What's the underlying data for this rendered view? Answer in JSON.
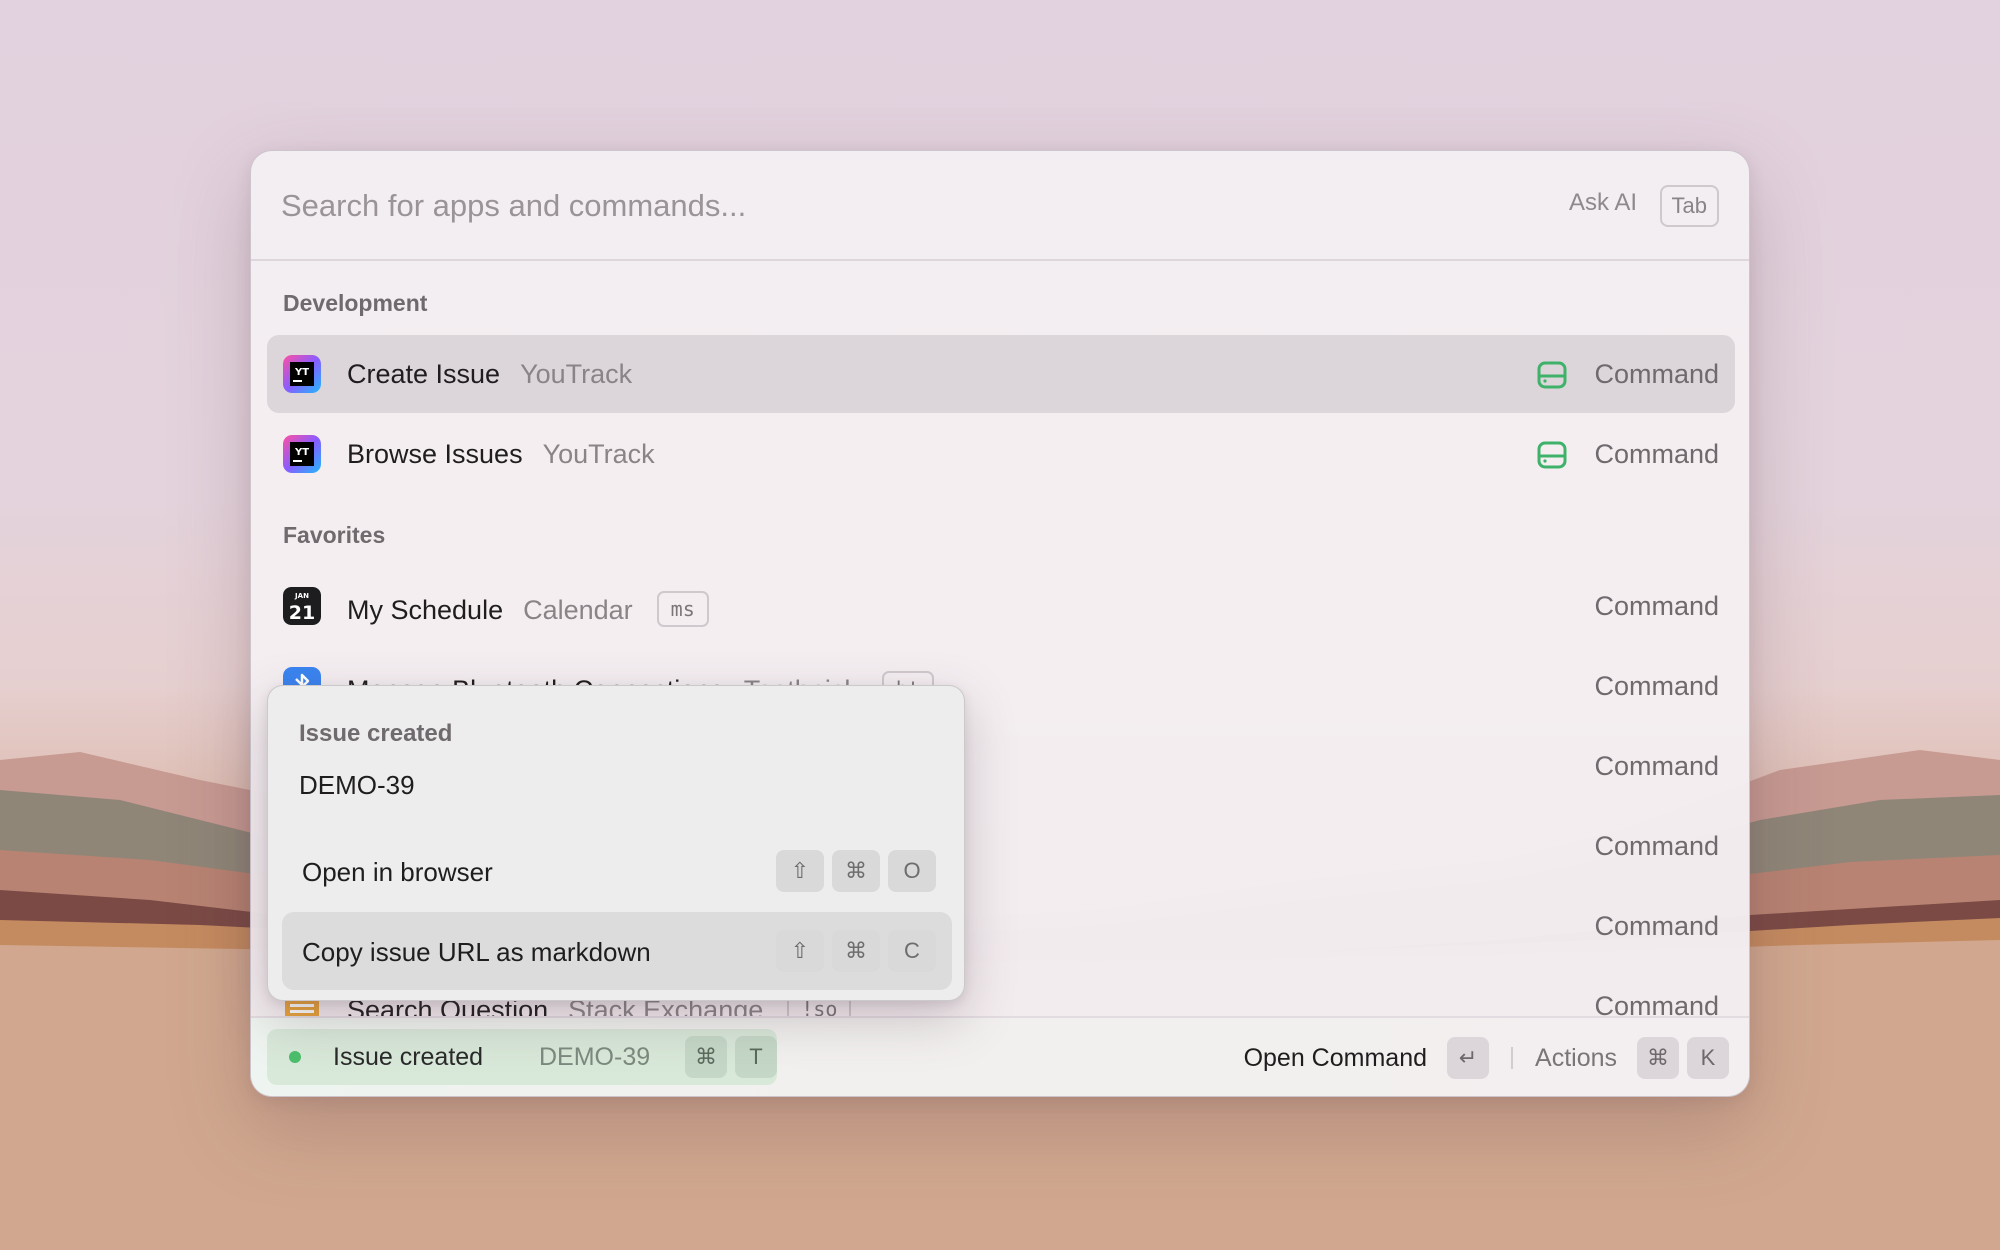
{
  "search": {
    "placeholder": "Search for apps and commands...",
    "ask_ai": "Ask AI",
    "tab_key": "Tab"
  },
  "sections": [
    {
      "title": "Development",
      "items": [
        {
          "title": "Create Issue",
          "subtitle": "YouTrack",
          "type": "Command",
          "icon": "youtrack-icon",
          "selected": true
        },
        {
          "title": "Browse Issues",
          "subtitle": "YouTrack",
          "type": "Command",
          "icon": "youtrack-icon"
        }
      ]
    },
    {
      "title": "Favorites",
      "items": [
        {
          "title": "My Schedule",
          "subtitle": "Calendar",
          "keyword": "ms",
          "type": "Command",
          "icon": "calendar-icon",
          "calendar_month": "JAN",
          "calendar_day": "21"
        },
        {
          "title": "Manage Bluetooth Connections",
          "subtitle": "Toothpick",
          "keyword": "bt",
          "type": "Command",
          "icon": "bluetooth-icon"
        },
        {
          "type": "Command"
        },
        {
          "type": "Command"
        },
        {
          "type": "Command"
        },
        {
          "title": "Search Question",
          "subtitle": "Stack Exchange",
          "keyword": "!so",
          "type": "Command",
          "icon": "stack-exchange-icon"
        }
      ]
    }
  ],
  "popover": {
    "title": "Issue created",
    "issue_id": "DEMO-39",
    "actions": [
      {
        "label": "Open in browser",
        "keys": [
          "⇧",
          "⌘",
          "O"
        ]
      },
      {
        "label": "Copy issue URL as markdown",
        "keys": [
          "⇧",
          "⌘",
          "C"
        ],
        "selected": true
      }
    ]
  },
  "footer": {
    "toast_title": "Issue created",
    "toast_id": "DEMO-39",
    "toast_keys": [
      "⌘",
      "T"
    ],
    "primary_action": "Open Command",
    "primary_key": "↵",
    "actions_label": "Actions",
    "actions_keys": [
      "⌘",
      "K"
    ]
  },
  "colors": {
    "toast_dot": "#4cbf6c",
    "extension_icon": "#3fb26a",
    "selection": "#dcd5da"
  }
}
